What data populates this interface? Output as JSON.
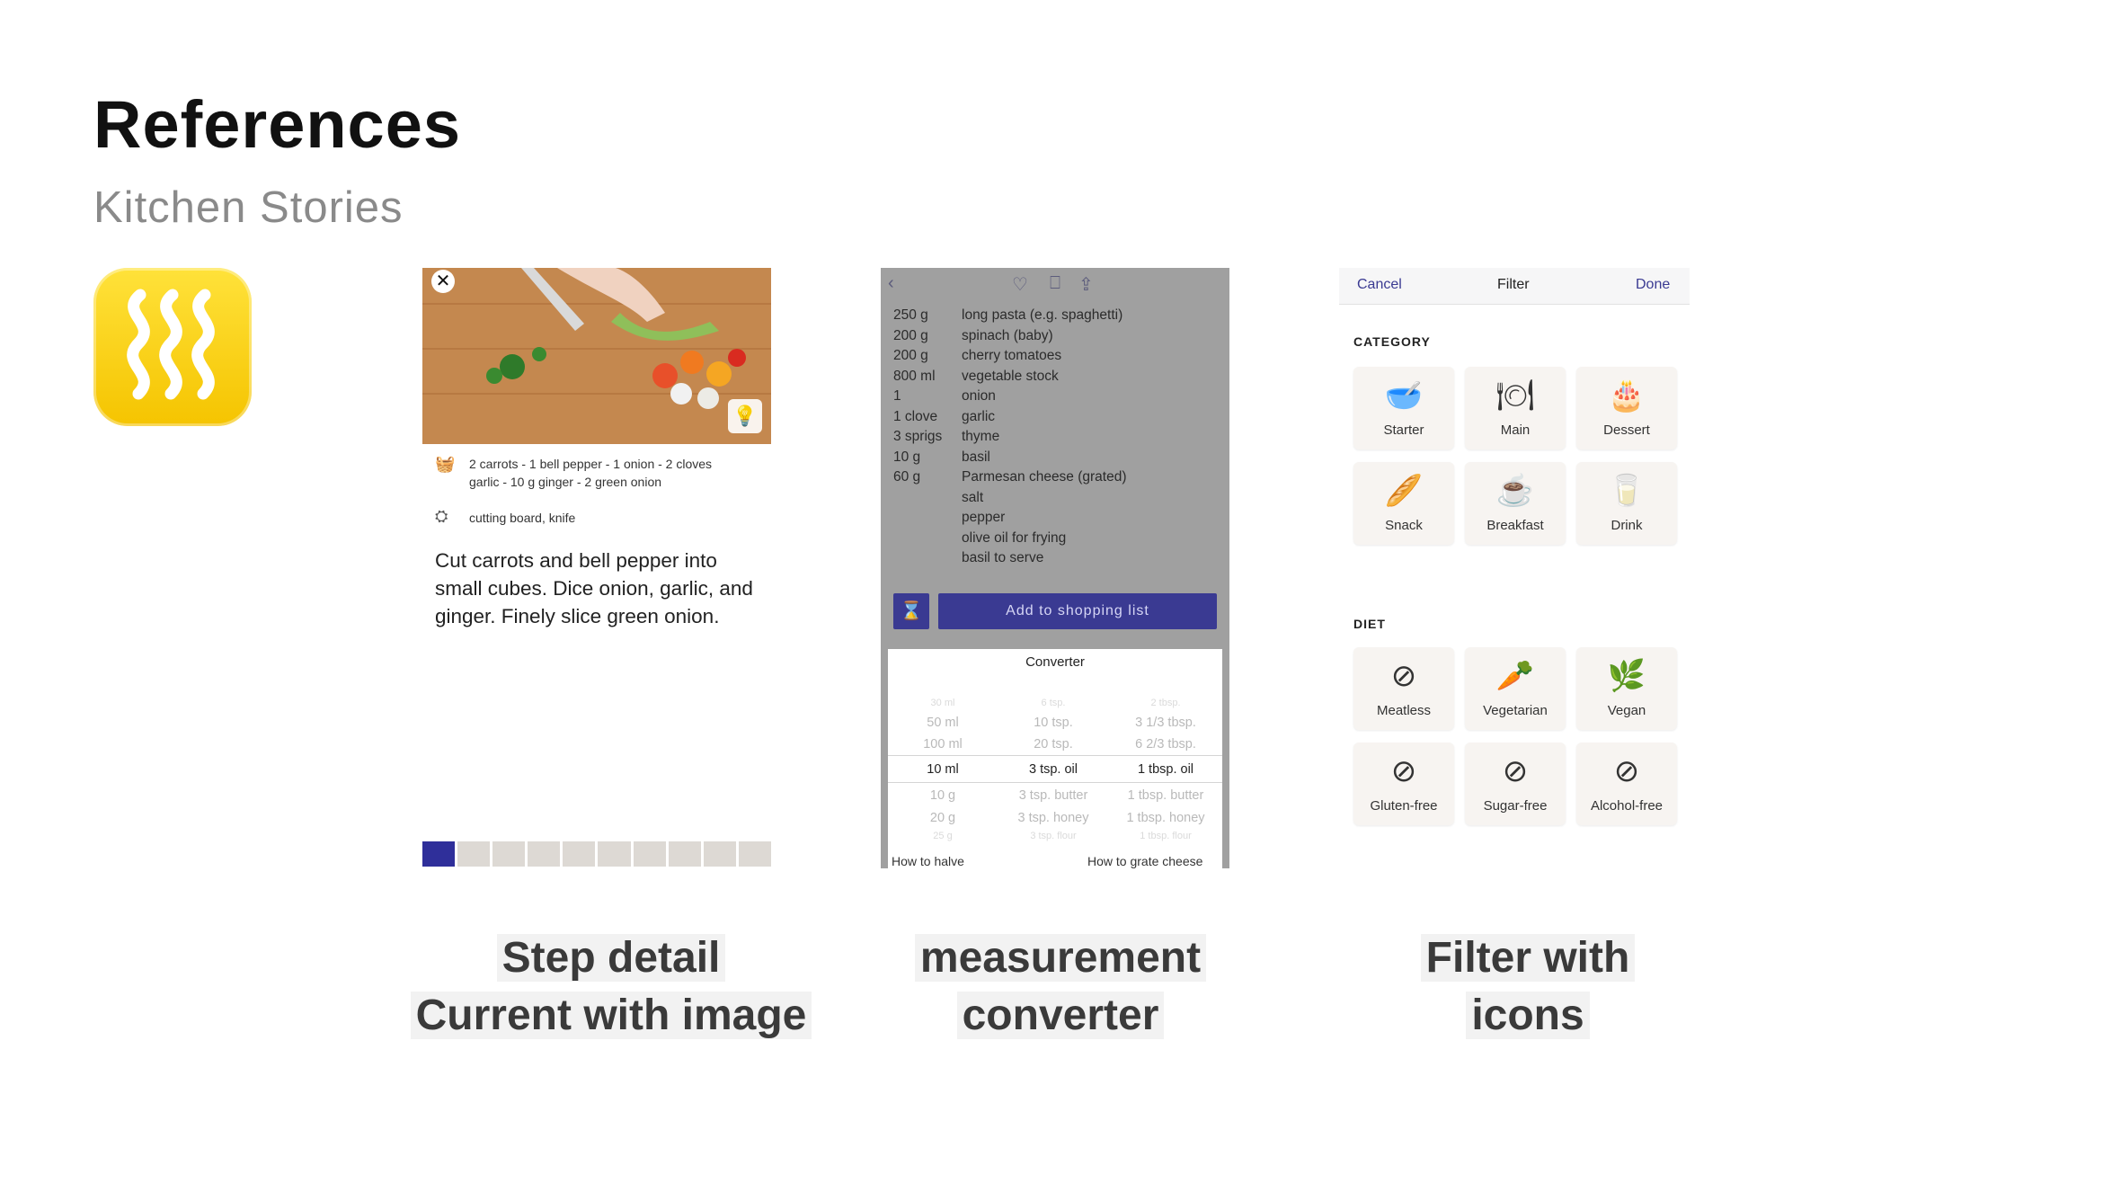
{
  "header": {
    "title": "References",
    "subtitle": "Kitchen Stories"
  },
  "app_icon": {
    "name": "steam-waves-icon",
    "color": "#F5C400"
  },
  "screen1": {
    "close_glyph": "✕",
    "ingredients_line1": "2 carrots - 1 bell pepper - 1 onion - 2 cloves",
    "ingredients_line2": "garlic - 10 g ginger - 2 green onion",
    "utensils": "cutting board, knife",
    "step_text": "Cut carrots and bell pepper into small cubes. Dice onion, garlic, and ginger. Finely slice green onion.",
    "progress_total": 10,
    "progress_current": 1,
    "progress_color": "#2F2F9A"
  },
  "screen2": {
    "ingredients": [
      {
        "amount": "250 g",
        "name": "long pasta (e.g. spaghetti)"
      },
      {
        "amount": "200 g",
        "name": "spinach (baby)"
      },
      {
        "amount": "200 g",
        "name": "cherry tomatoes"
      },
      {
        "amount": "800 ml",
        "name": "vegetable stock"
      },
      {
        "amount": "1",
        "name": "onion"
      },
      {
        "amount": "1 clove",
        "name": "garlic"
      },
      {
        "amount": "3 sprigs",
        "name": "thyme"
      },
      {
        "amount": "10 g",
        "name": "basil"
      },
      {
        "amount": "60 g",
        "name": "Parmesan cheese (grated)"
      },
      {
        "amount": "",
        "name": "salt"
      },
      {
        "amount": "",
        "name": "pepper"
      },
      {
        "amount": "",
        "name": "olive oil for frying"
      },
      {
        "amount": "",
        "name": "basil to serve"
      }
    ],
    "add_button": "Add to shopping list",
    "converter": {
      "title": "Converter",
      "rows": [
        [
          "30 ml",
          "6 tsp.",
          "2 tbsp."
        ],
        [
          "50 ml",
          "10 tsp.",
          "3 1/3 tbsp."
        ],
        [
          "100 ml",
          "20 tsp.",
          "6 2/3 tbsp."
        ],
        [
          "10 ml",
          "3 tsp. oil",
          "1 tbsp. oil"
        ],
        [
          "10 g",
          "3 tsp. butter",
          "1 tbsp. butter"
        ],
        [
          "20 g",
          "3 tsp. honey",
          "1 tbsp. honey"
        ],
        [
          "25 g",
          "3 tsp. flour",
          "1 tbsp. flour"
        ]
      ],
      "selected_index": 3
    },
    "bottom_left": "How to halve",
    "bottom_right": "How to grate cheese",
    "accent_color": "#3A3A92"
  },
  "screen3": {
    "nav": {
      "cancel": "Cancel",
      "title": "Filter",
      "done": "Done"
    },
    "category_label": "CATEGORY",
    "categories": [
      {
        "label": "Starter",
        "icon": "bowl-icon"
      },
      {
        "label": "Main",
        "icon": "plate-cutlery-icon"
      },
      {
        "label": "Dessert",
        "icon": "cake-icon"
      },
      {
        "label": "Snack",
        "icon": "baguette-icon"
      },
      {
        "label": "Breakfast",
        "icon": "coffee-cup-icon"
      },
      {
        "label": "Drink",
        "icon": "glass-icon"
      }
    ],
    "diet_label": "DIET",
    "diets": [
      {
        "label": "Meatless",
        "icon": "no-meat-icon"
      },
      {
        "label": "Vegetarian",
        "icon": "carrot-icon"
      },
      {
        "label": "Vegan",
        "icon": "leaf-icon"
      },
      {
        "label": "Gluten-free",
        "icon": "no-wheat-icon"
      },
      {
        "label": "Sugar-free",
        "icon": "no-sugar-icon"
      },
      {
        "label": "Alcohol-free",
        "icon": "no-alcohol-icon"
      }
    ]
  },
  "captions": {
    "c1_line1": "Step detail",
    "c1_line2": "Current with image",
    "c2_line1": "measurement",
    "c2_line2": "converter",
    "c3_line1": "Filter with",
    "c3_line2": "icons"
  }
}
